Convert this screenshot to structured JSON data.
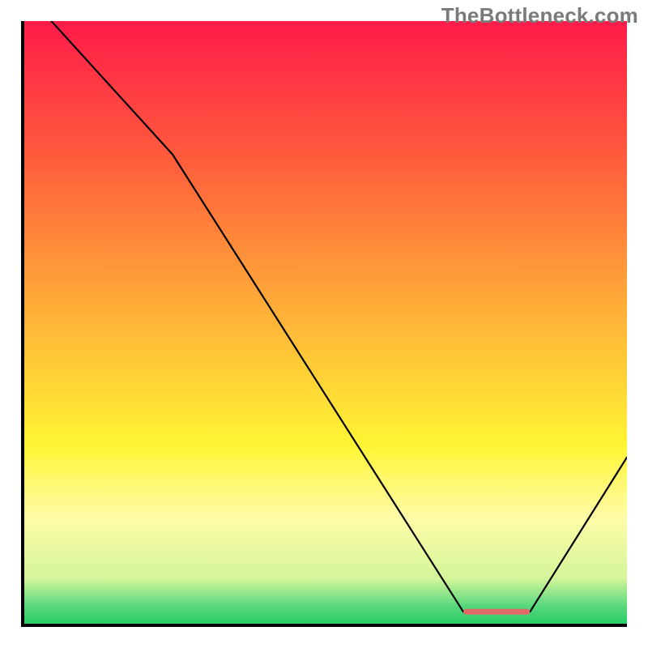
{
  "watermark": "TheBottleneck.com",
  "chart_data": {
    "type": "line",
    "title": "",
    "xlabel": "",
    "ylabel": "",
    "xlim": [
      0,
      100
    ],
    "ylim": [
      0,
      100
    ],
    "grid": false,
    "legend": false,
    "series": [
      {
        "name": "bottleneck-curve",
        "x": [
          5,
          25,
          73,
          82,
          84,
          100
        ],
        "y": [
          100,
          78,
          2.5,
          2.5,
          2.5,
          28
        ],
        "stroke": "#000000",
        "stroke_width": 2.2
      }
    ],
    "marker": {
      "name": "optimal-range",
      "x_start": 73,
      "x_end": 84,
      "y": 2.5,
      "fill": "#e06969",
      "radius": 3.5
    },
    "background_gradient": {
      "stops": [
        {
          "offset": 0.0,
          "color": "#ff1b4a"
        },
        {
          "offset": 0.22,
          "color": "#ff5a3c"
        },
        {
          "offset": 0.5,
          "color": "#ffb638"
        },
        {
          "offset": 0.7,
          "color": "#fff534"
        },
        {
          "offset": 0.82,
          "color": "#fffca8"
        },
        {
          "offset": 0.92,
          "color": "#d4f59a"
        },
        {
          "offset": 0.965,
          "color": "#5ad87e"
        },
        {
          "offset": 1.0,
          "color": "#1ecb62"
        }
      ]
    },
    "axis_stroke": "#000000",
    "axis_stroke_width": 4
  }
}
